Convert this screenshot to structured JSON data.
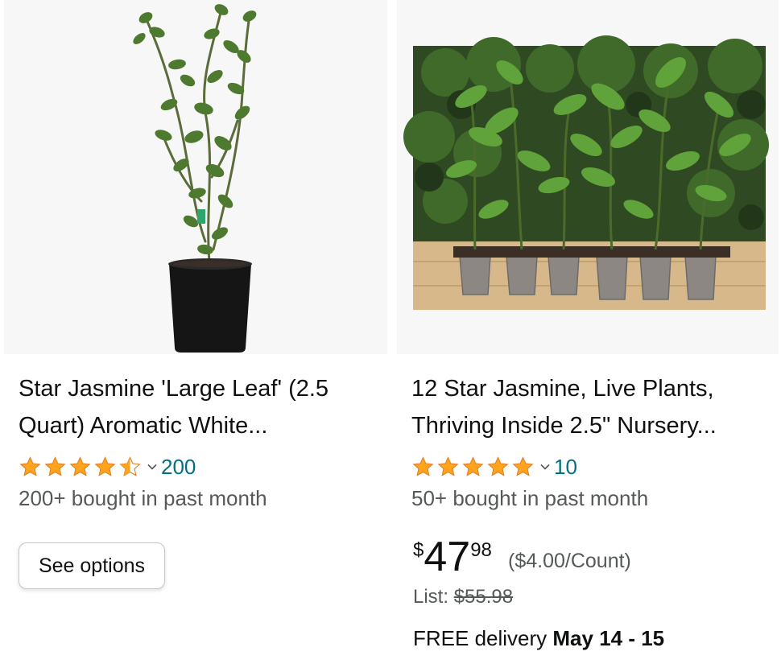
{
  "colors": {
    "star": "#ffa41c",
    "link": "#007185",
    "secondary_text": "#565959",
    "primary_text": "#0f1111"
  },
  "products": [
    {
      "title": "Star Jasmine 'Large Leaf' (2.5 Quart) Aromatic White...",
      "rating_stars": 4.5,
      "rating_count": "200",
      "bought": "200+ bought in past month",
      "button_label": "See options"
    },
    {
      "title": "12 Star Jasmine, Live Plants, Thriving Inside 2.5\" Nursery...",
      "rating_stars": 5,
      "rating_count": "10",
      "bought": "50+ bought in past month",
      "price": {
        "symbol": "$",
        "whole": "47",
        "fraction": "98",
        "per_unit": "($4.00/Count)"
      },
      "list_label": "List: ",
      "list_price": "$55.98",
      "delivery_prefix": "FREE delivery ",
      "delivery_date": "May 14 - 15"
    }
  ]
}
